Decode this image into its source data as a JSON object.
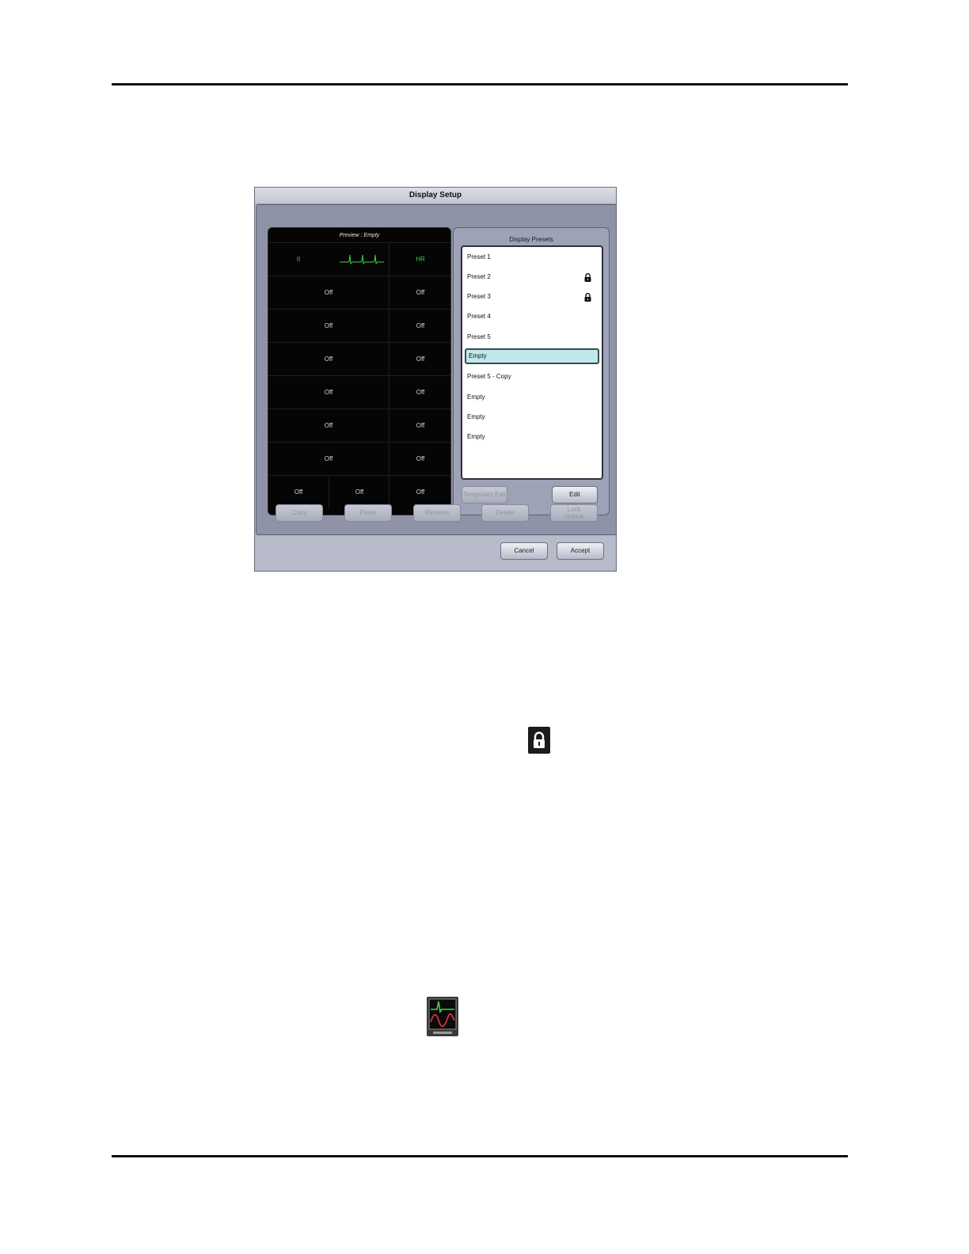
{
  "dialog": {
    "title": "Display Setup",
    "preview": {
      "title": "Preview :   Empty",
      "rows": [
        {
          "cells": [
            "II",
            "",
            "HR"
          ]
        },
        {
          "cells": [
            "Off",
            "Off"
          ]
        },
        {
          "cells": [
            "Off",
            "Off"
          ]
        },
        {
          "cells": [
            "Off",
            "Off"
          ]
        },
        {
          "cells": [
            "Off",
            "Off"
          ]
        },
        {
          "cells": [
            "Off",
            "Off"
          ]
        },
        {
          "cells": [
            "Off",
            "Off"
          ]
        },
        {
          "cells": [
            "Off",
            "Off",
            "Off"
          ]
        }
      ]
    },
    "presets": {
      "title": "Display Presets",
      "items": [
        {
          "label": "Preset 1",
          "locked": false
        },
        {
          "label": "Preset 2",
          "locked": true
        },
        {
          "label": "Preset 3",
          "locked": true
        },
        {
          "label": "Preset 4",
          "locked": false
        },
        {
          "label": "Preset 5",
          "locked": false
        },
        {
          "label": "Empty",
          "locked": false,
          "selected": true
        },
        {
          "label": "Preset 5 - Copy",
          "locked": false
        },
        {
          "label": "Empty",
          "locked": false
        },
        {
          "label": "Empty",
          "locked": false
        },
        {
          "label": "Empty",
          "locked": false
        }
      ],
      "temporary_edit_label": "Temporary Edit",
      "edit_label": "Edit"
    },
    "actions": {
      "copy": "Copy",
      "paste": "Paste",
      "rename": "Rename",
      "delete": "Delete",
      "lock_unlock_line1": "Lock",
      "lock_unlock_line2": "Unlock"
    },
    "footer": {
      "cancel": "Cancel",
      "accept": "Accept"
    }
  },
  "icons": {
    "lock": "lock-icon",
    "display": "display-setup-icon"
  },
  "colors": {
    "waveform_green": "#3ed43e",
    "waveform_red": "#e0303a",
    "selected_row": "#bfe8ea"
  }
}
